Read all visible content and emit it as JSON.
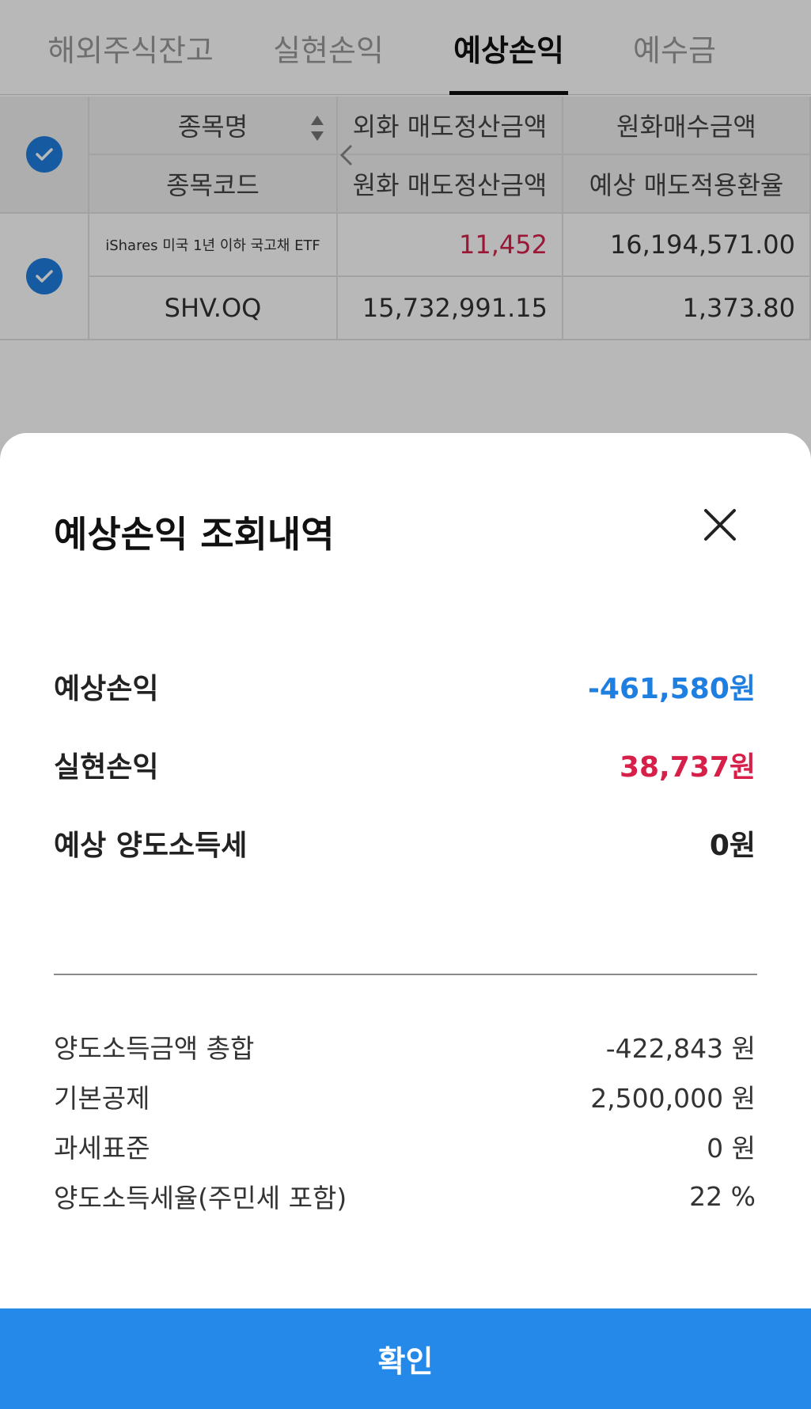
{
  "tabs": [
    {
      "label": "해외주식잔고"
    },
    {
      "label": "실현손익"
    },
    {
      "label": "예상손익"
    },
    {
      "label": "예수금"
    }
  ],
  "table": {
    "headers": {
      "col1_top": "종목명",
      "col1_bottom": "종목코드",
      "col2_top": "외화 매도정산금액",
      "col2_bottom": "원화 매도정산금액",
      "col3_top": "원화매수금액",
      "col3_bottom": "예상 매도적용환율"
    },
    "rows": [
      {
        "name": "iShares 미국 1년 이하 국고채 ETF",
        "code": "SHV.OQ",
        "foreign_sell": "11,452",
        "krw_sell": "15,732,991.15",
        "krw_buy": "16,194,571.00",
        "exchange_rate": "1,373.80"
      }
    ]
  },
  "sheet": {
    "title": "예상손익 조회내역",
    "expected_pl_label": "예상손익",
    "expected_pl_value": "-461,580원",
    "realized_pl_label": "실현손익",
    "realized_pl_value": "38,737원",
    "expected_tax_label": "예상 양도소득세",
    "expected_tax_value": "0원",
    "details": [
      {
        "label": "양도소득금액 총합",
        "value": "-422,843 원"
      },
      {
        "label": "기본공제",
        "value": "2,500,000 원"
      },
      {
        "label": "과세표준",
        "value": "0 원"
      },
      {
        "label": "양도소득세율(주민세 포함)",
        "value": "22 %"
      }
    ],
    "confirm_label": "확인"
  },
  "colors": {
    "accent_blue": "#1f7fe0",
    "loss_blue": "#1f7fe0",
    "profit_red": "#d6204a",
    "confirm_button": "#2489e8"
  }
}
